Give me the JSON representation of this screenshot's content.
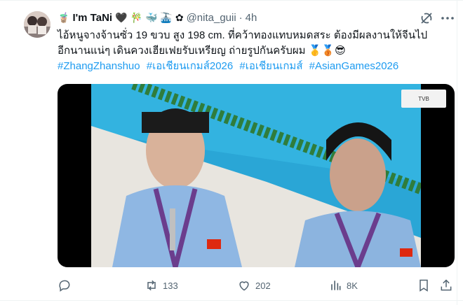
{
  "tweet": {
    "author_name": "I'm TaNi",
    "name_emojis": [
      "🧋",
      "🖤",
      "🎋",
      "🐳",
      "🚠",
      "✿"
    ],
    "handle": "@nita_guii",
    "separator": "·",
    "time": "4h",
    "text_line1": "ไอ้หนูจางจ้านซั่ว 19 ขวบ สูง 198 cm. ที่คว้าทองแทบหมดสระ ต้องมีผลงานให้จีนไป",
    "text_line2": "อีกนานแน่ๆ เดินควงเฮียเฟยรับเหรียญ ถ่ายรูปกันครับผม",
    "text_line2_emojis": [
      "🥇",
      "🥉",
      "😎"
    ],
    "hashtags": [
      "#ZhangZhanshuo",
      "#เอเชียนเกมส์2026",
      "#เอเชียนเกมส์",
      "#AsianGames2026"
    ]
  },
  "media": {
    "type": "video",
    "description": "Swimmers in light blue jackets wearing medals beside pool",
    "broadcast_logo": "TVB"
  },
  "actions": {
    "reply_count": "",
    "retweet_count": "133",
    "like_count": "202",
    "views_count": "8K"
  },
  "icons": {
    "grok": "grok-icon",
    "more": "more-icon",
    "reply": "reply-icon",
    "retweet": "retweet-icon",
    "like": "heart-icon",
    "views": "views-icon",
    "bookmark": "bookmark-icon",
    "share": "share-icon"
  },
  "colors": {
    "link": "#1d9bf0",
    "muted": "#536471",
    "text": "#0f1419"
  }
}
